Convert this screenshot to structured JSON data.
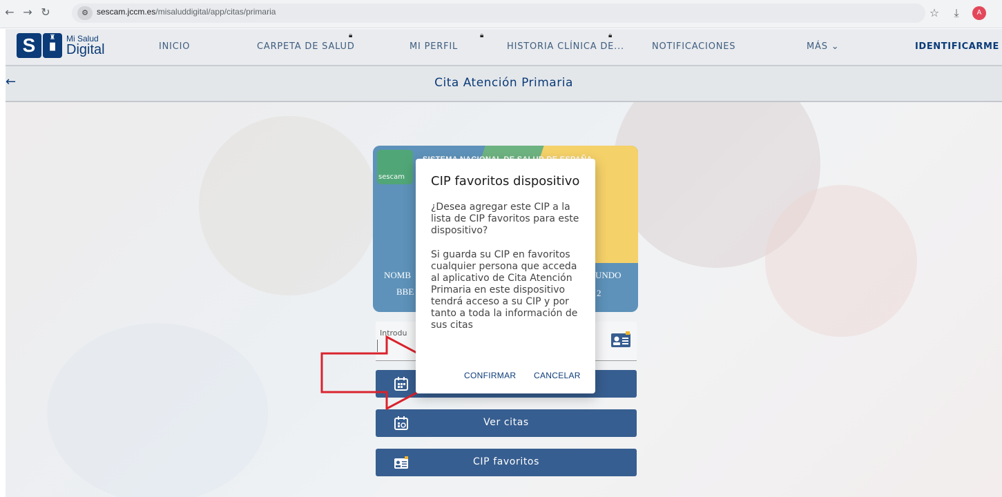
{
  "browser": {
    "url_domain": "sescam.jccm.es",
    "url_path": "/misaluddigital/app/citas/primaria",
    "avatar_letter": "A"
  },
  "header": {
    "logo_line1": "Mi Salud",
    "logo_line2": "Digital",
    "nav": [
      {
        "label": "INICIO",
        "locked": false
      },
      {
        "label": "CARPETA DE SALUD",
        "locked": true
      },
      {
        "label": "MI PERFIL",
        "locked": true
      },
      {
        "label": "HISTORIA CLÍNICA DE...",
        "locked": true
      },
      {
        "label": "NOTIFICACIONES",
        "locked": false
      },
      {
        "label": "MÁS ⌄",
        "locked": false
      }
    ],
    "login_label": "IDENTIFICARME"
  },
  "page": {
    "title": "Cita Atención Primaria"
  },
  "card": {
    "brand": "sescam",
    "system_name": "SISTEMA NACIONAL DE SALUD DE ESPAÑA",
    "name_left": "NOMB",
    "name_left2": "BBE",
    "name_right": "UNDO",
    "num_right": "2"
  },
  "input": {
    "label": "Introdu"
  },
  "buttons": {
    "primary_label": "",
    "view_label": "Ver citas",
    "fav_label": "CIP favoritos"
  },
  "dialog": {
    "title": "CIP favoritos dispositivo",
    "question": "¿Desea agregar este CIP a la lista de CIP favoritos para este dispositivo?",
    "warning": "Si guarda su CIP en favoritos cualquier persona que acceda al aplicativo de Cita Atención Primaria en este dispositivo tendrá acceso a su CIP y por tanto a toda la información de sus citas",
    "confirm_label": "CONFIRMAR",
    "cancel_label": "CANCELAR"
  },
  "colors": {
    "brand_blue": "#0b3b78",
    "arrow_red": "#d9232d"
  }
}
